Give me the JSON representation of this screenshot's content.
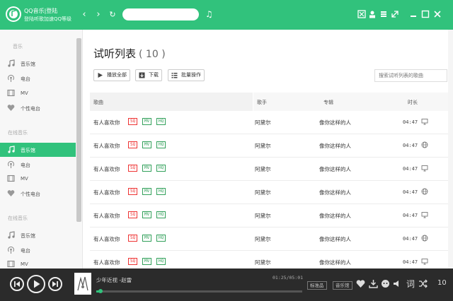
{
  "header": {
    "title_line1": "QQ音乐|登陆",
    "title_line2": "登陆听歌加速QQ等级",
    "search_placeholder": "",
    "nav": {
      "back": "‹",
      "forward": "›",
      "refresh": "↻"
    },
    "music_icon": "♫",
    "window_icons": [
      "skin-icon",
      "user-icon",
      "menu-icon",
      "mini-mode-icon",
      "minimize-icon",
      "maximize-icon",
      "close-icon"
    ]
  },
  "sidebar": {
    "sections": [
      {
        "label": "音乐",
        "items": [
          {
            "label": "音乐馆",
            "icon": "music-note-icon"
          },
          {
            "label": "电台",
            "icon": "radio-icon"
          },
          {
            "label": "MV",
            "icon": "mv-icon"
          },
          {
            "label": "个性电台",
            "icon": "heart-icon"
          }
        ]
      },
      {
        "label": "在线音乐",
        "items": [
          {
            "label": "音乐馆",
            "icon": "music-note-icon",
            "active": true
          },
          {
            "label": "电台",
            "icon": "radio-icon"
          },
          {
            "label": "MV",
            "icon": "mv-icon"
          },
          {
            "label": "个性电台",
            "icon": "heart-icon"
          }
        ]
      },
      {
        "label": "在线音乐",
        "items": [
          {
            "label": "音乐馆",
            "icon": "music-note-icon"
          },
          {
            "label": "电台",
            "icon": "radio-icon"
          },
          {
            "label": "MV",
            "icon": "mv-icon"
          }
        ]
      }
    ]
  },
  "main": {
    "title": "试听列表",
    "count": "( 10 )",
    "buttons": {
      "play_all": "播放全部",
      "download": "下载",
      "batch": "批量操作"
    },
    "search_placeholder": "搜索试听列表的歌曲",
    "columns": {
      "song": "歌曲",
      "singer": "歌手",
      "album": "专辑",
      "duration": "时长"
    },
    "tags": {
      "sq": "SQ",
      "mv": "MV",
      "hq": "HQ"
    },
    "rows": [
      {
        "song": "有人喜欢你",
        "singer": "阿黛尔",
        "album": "像你这样的人",
        "duration": "04:47",
        "icon": "monitor-icon"
      },
      {
        "song": "有人喜欢你",
        "singer": "阿黛尔",
        "album": "像你这样的人",
        "duration": "04:47",
        "icon": "globe-icon"
      },
      {
        "song": "有人喜欢你",
        "singer": "阿黛尔",
        "album": "像你这样的人",
        "duration": "04:47",
        "icon": "monitor-icon"
      },
      {
        "song": "有人喜欢你",
        "singer": "阿黛尔",
        "album": "像你这样的人",
        "duration": "04:47",
        "icon": "globe-icon"
      },
      {
        "song": "有人喜欢你",
        "singer": "阿黛尔",
        "album": "像你这样的人",
        "duration": "04:47",
        "icon": "monitor-icon"
      },
      {
        "song": "有人喜欢你",
        "singer": "阿黛尔",
        "album": "像你这样的人",
        "duration": "04:47",
        "icon": "globe-icon"
      },
      {
        "song": "有人喜欢你",
        "singer": "阿黛尔",
        "album": "像你这样的人",
        "duration": "04:47",
        "icon": "monitor-icon"
      }
    ]
  },
  "player": {
    "song": "少年近视  -赵雷",
    "time": "01:25/05:01",
    "progress": 0.02,
    "quality_label": "标准品",
    "effect_label": "音乐馆",
    "lyric_icon_text": "词",
    "volume_text": "10"
  },
  "colors": {
    "accent": "#31c27c",
    "player_bg": "#2b2b2b",
    "sq_tag": "#e33333",
    "hq_tag": "#31a05a"
  }
}
